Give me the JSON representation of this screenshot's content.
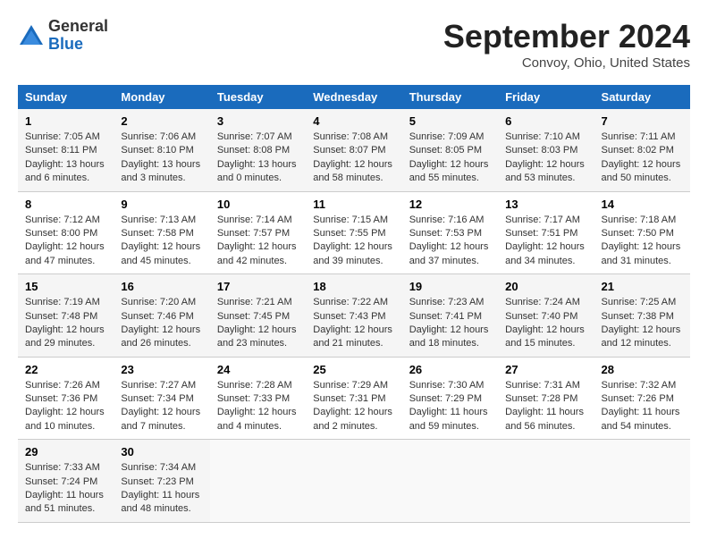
{
  "header": {
    "logo_general": "General",
    "logo_blue": "Blue",
    "title": "September 2024",
    "location": "Convoy, Ohio, United States"
  },
  "columns": [
    "Sunday",
    "Monday",
    "Tuesday",
    "Wednesday",
    "Thursday",
    "Friday",
    "Saturday"
  ],
  "weeks": [
    [
      {
        "day": "1",
        "sunrise": "Sunrise: 7:05 AM",
        "sunset": "Sunset: 8:11 PM",
        "daylight": "Daylight: 13 hours and 6 minutes."
      },
      {
        "day": "2",
        "sunrise": "Sunrise: 7:06 AM",
        "sunset": "Sunset: 8:10 PM",
        "daylight": "Daylight: 13 hours and 3 minutes."
      },
      {
        "day": "3",
        "sunrise": "Sunrise: 7:07 AM",
        "sunset": "Sunset: 8:08 PM",
        "daylight": "Daylight: 13 hours and 0 minutes."
      },
      {
        "day": "4",
        "sunrise": "Sunrise: 7:08 AM",
        "sunset": "Sunset: 8:07 PM",
        "daylight": "Daylight: 12 hours and 58 minutes."
      },
      {
        "day": "5",
        "sunrise": "Sunrise: 7:09 AM",
        "sunset": "Sunset: 8:05 PM",
        "daylight": "Daylight: 12 hours and 55 minutes."
      },
      {
        "day": "6",
        "sunrise": "Sunrise: 7:10 AM",
        "sunset": "Sunset: 8:03 PM",
        "daylight": "Daylight: 12 hours and 53 minutes."
      },
      {
        "day": "7",
        "sunrise": "Sunrise: 7:11 AM",
        "sunset": "Sunset: 8:02 PM",
        "daylight": "Daylight: 12 hours and 50 minutes."
      }
    ],
    [
      {
        "day": "8",
        "sunrise": "Sunrise: 7:12 AM",
        "sunset": "Sunset: 8:00 PM",
        "daylight": "Daylight: 12 hours and 47 minutes."
      },
      {
        "day": "9",
        "sunrise": "Sunrise: 7:13 AM",
        "sunset": "Sunset: 7:58 PM",
        "daylight": "Daylight: 12 hours and 45 minutes."
      },
      {
        "day": "10",
        "sunrise": "Sunrise: 7:14 AM",
        "sunset": "Sunset: 7:57 PM",
        "daylight": "Daylight: 12 hours and 42 minutes."
      },
      {
        "day": "11",
        "sunrise": "Sunrise: 7:15 AM",
        "sunset": "Sunset: 7:55 PM",
        "daylight": "Daylight: 12 hours and 39 minutes."
      },
      {
        "day": "12",
        "sunrise": "Sunrise: 7:16 AM",
        "sunset": "Sunset: 7:53 PM",
        "daylight": "Daylight: 12 hours and 37 minutes."
      },
      {
        "day": "13",
        "sunrise": "Sunrise: 7:17 AM",
        "sunset": "Sunset: 7:51 PM",
        "daylight": "Daylight: 12 hours and 34 minutes."
      },
      {
        "day": "14",
        "sunrise": "Sunrise: 7:18 AM",
        "sunset": "Sunset: 7:50 PM",
        "daylight": "Daylight: 12 hours and 31 minutes."
      }
    ],
    [
      {
        "day": "15",
        "sunrise": "Sunrise: 7:19 AM",
        "sunset": "Sunset: 7:48 PM",
        "daylight": "Daylight: 12 hours and 29 minutes."
      },
      {
        "day": "16",
        "sunrise": "Sunrise: 7:20 AM",
        "sunset": "Sunset: 7:46 PM",
        "daylight": "Daylight: 12 hours and 26 minutes."
      },
      {
        "day": "17",
        "sunrise": "Sunrise: 7:21 AM",
        "sunset": "Sunset: 7:45 PM",
        "daylight": "Daylight: 12 hours and 23 minutes."
      },
      {
        "day": "18",
        "sunrise": "Sunrise: 7:22 AM",
        "sunset": "Sunset: 7:43 PM",
        "daylight": "Daylight: 12 hours and 21 minutes."
      },
      {
        "day": "19",
        "sunrise": "Sunrise: 7:23 AM",
        "sunset": "Sunset: 7:41 PM",
        "daylight": "Daylight: 12 hours and 18 minutes."
      },
      {
        "day": "20",
        "sunrise": "Sunrise: 7:24 AM",
        "sunset": "Sunset: 7:40 PM",
        "daylight": "Daylight: 12 hours and 15 minutes."
      },
      {
        "day": "21",
        "sunrise": "Sunrise: 7:25 AM",
        "sunset": "Sunset: 7:38 PM",
        "daylight": "Daylight: 12 hours and 12 minutes."
      }
    ],
    [
      {
        "day": "22",
        "sunrise": "Sunrise: 7:26 AM",
        "sunset": "Sunset: 7:36 PM",
        "daylight": "Daylight: 12 hours and 10 minutes."
      },
      {
        "day": "23",
        "sunrise": "Sunrise: 7:27 AM",
        "sunset": "Sunset: 7:34 PM",
        "daylight": "Daylight: 12 hours and 7 minutes."
      },
      {
        "day": "24",
        "sunrise": "Sunrise: 7:28 AM",
        "sunset": "Sunset: 7:33 PM",
        "daylight": "Daylight: 12 hours and 4 minutes."
      },
      {
        "day": "25",
        "sunrise": "Sunrise: 7:29 AM",
        "sunset": "Sunset: 7:31 PM",
        "daylight": "Daylight: 12 hours and 2 minutes."
      },
      {
        "day": "26",
        "sunrise": "Sunrise: 7:30 AM",
        "sunset": "Sunset: 7:29 PM",
        "daylight": "Daylight: 11 hours and 59 minutes."
      },
      {
        "day": "27",
        "sunrise": "Sunrise: 7:31 AM",
        "sunset": "Sunset: 7:28 PM",
        "daylight": "Daylight: 11 hours and 56 minutes."
      },
      {
        "day": "28",
        "sunrise": "Sunrise: 7:32 AM",
        "sunset": "Sunset: 7:26 PM",
        "daylight": "Daylight: 11 hours and 54 minutes."
      }
    ],
    [
      {
        "day": "29",
        "sunrise": "Sunrise: 7:33 AM",
        "sunset": "Sunset: 7:24 PM",
        "daylight": "Daylight: 11 hours and 51 minutes."
      },
      {
        "day": "30",
        "sunrise": "Sunrise: 7:34 AM",
        "sunset": "Sunset: 7:23 PM",
        "daylight": "Daylight: 11 hours and 48 minutes."
      },
      null,
      null,
      null,
      null,
      null
    ]
  ]
}
